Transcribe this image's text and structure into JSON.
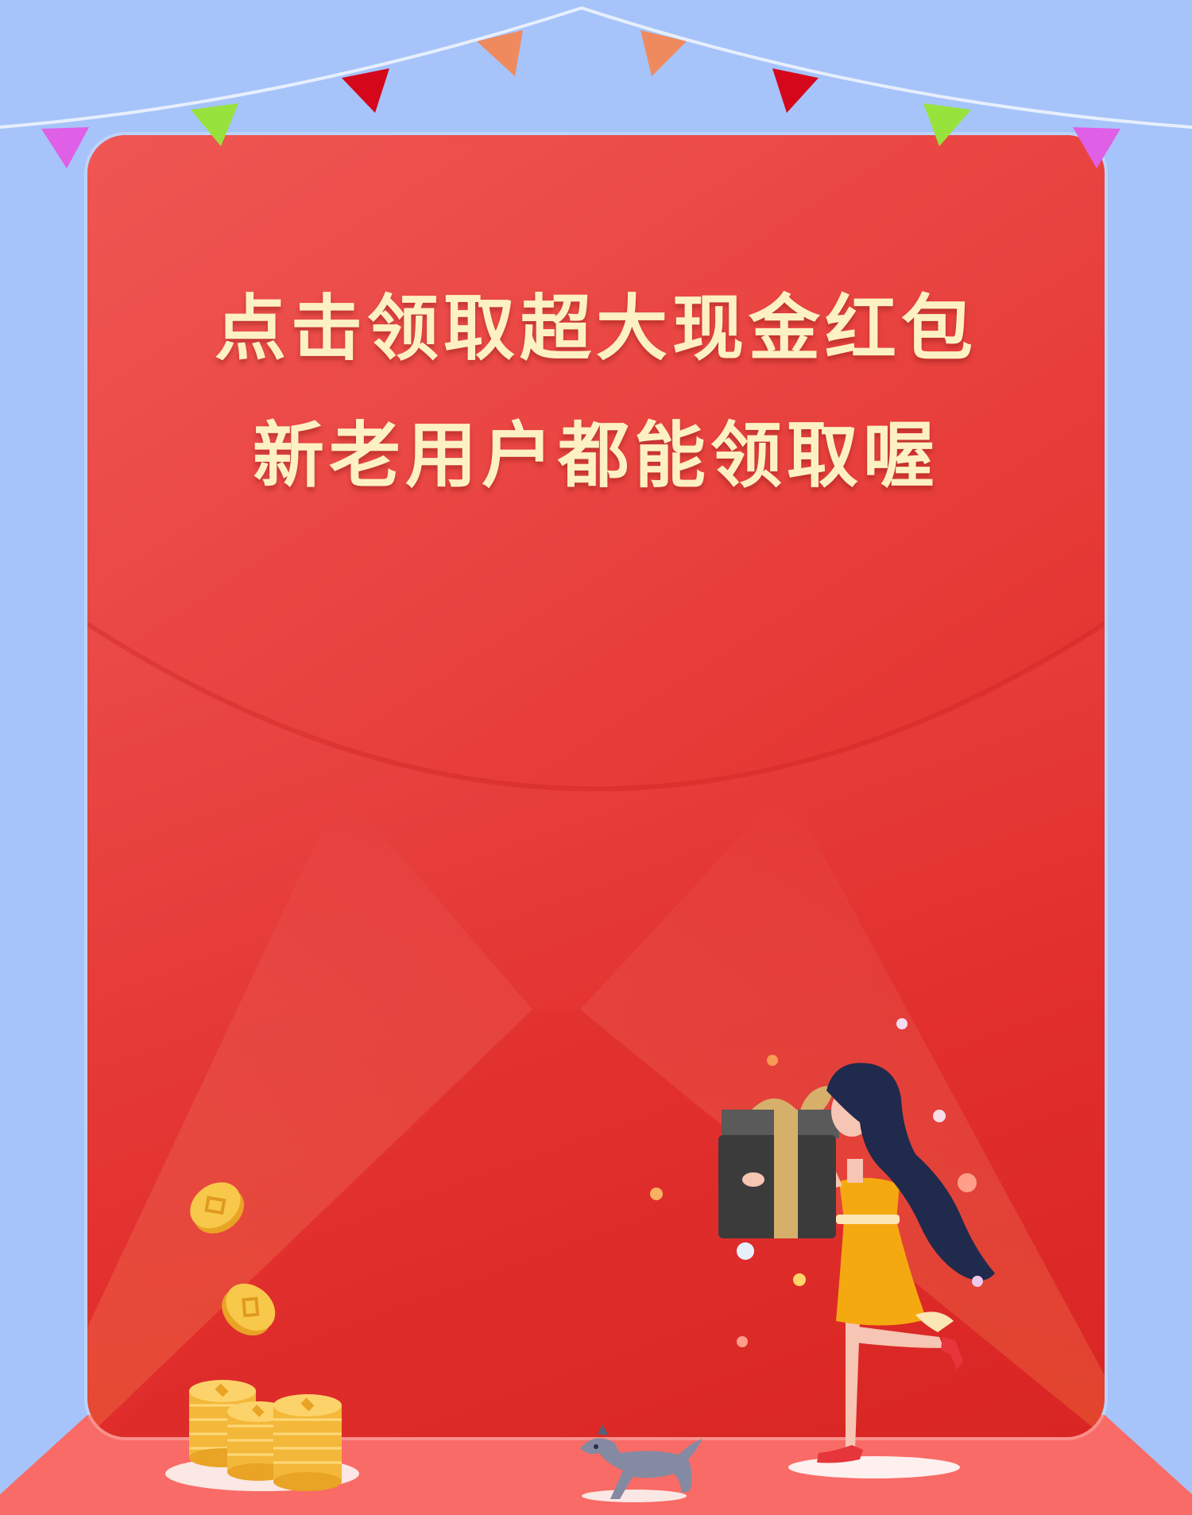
{
  "headline": {
    "line1": "点击领取超大现金红包",
    "line2": "新老用户都能领取喔"
  },
  "colors": {
    "background": "#a6c4fa",
    "envelope_red": "#e53935",
    "headline_cream": "#fdf1c4",
    "floor": "#f96b66",
    "coin_gold": "#f8c84a",
    "dress_yellow": "#f5a911",
    "hair_navy": "#1f2a4d",
    "gift_box": "#3b3b3b"
  },
  "icons": [
    "bunting-flag-icon",
    "gift-box-icon",
    "gold-coin-icon",
    "coin-stack-icon",
    "dog-icon",
    "confetti-dot-icon",
    "woman-figure-icon"
  ]
}
